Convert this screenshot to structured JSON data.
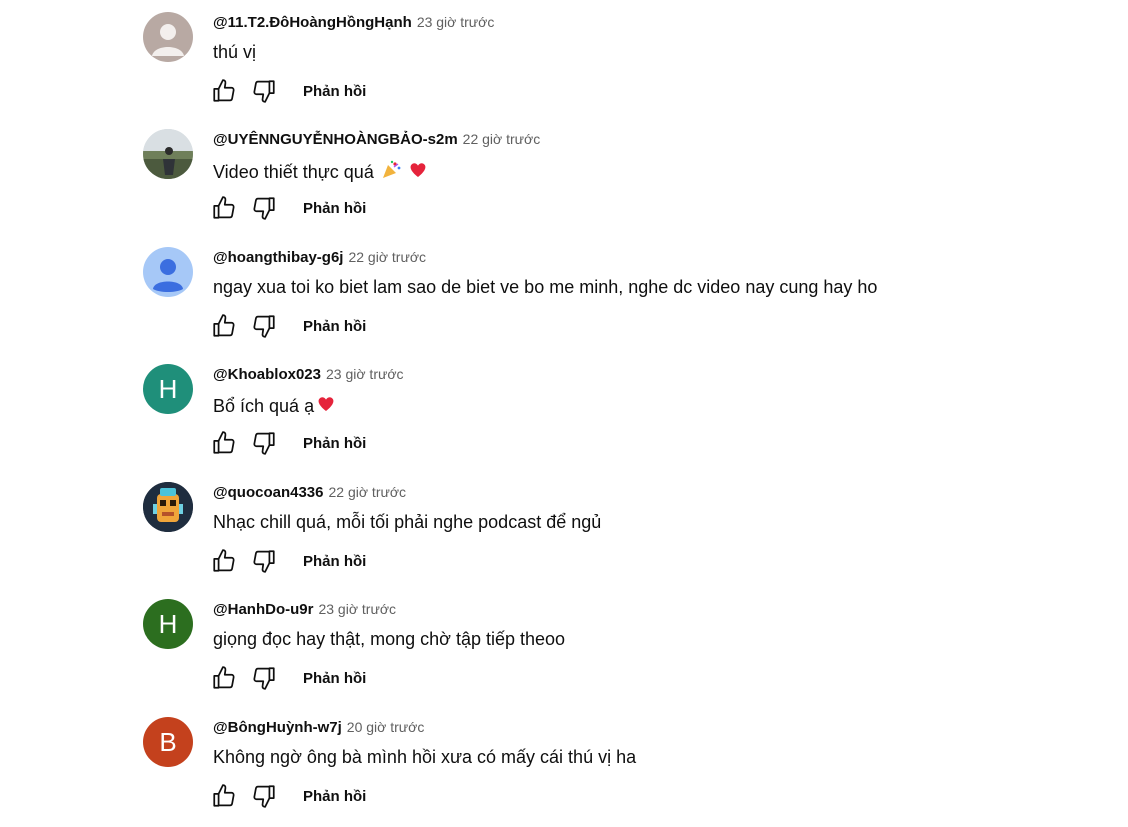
{
  "colors": {
    "text": "#0f0f0f",
    "meta": "#606060",
    "avatar_green": "#1f8f7a",
    "avatar_darkgreen": "#2c6e1f",
    "avatar_orange": "#c4411d",
    "avatar_gray": "#b8a9a3",
    "avatar_blue": "#a6c8f7",
    "heart": "#e5233b"
  },
  "reply_label": "Phản hồi",
  "comments": [
    {
      "author": "@11.T2.ĐôHoàngHồngHạnh",
      "time": "23 giờ trước",
      "text": "thú vị",
      "avatar": {
        "type": "default-person-icon",
        "bg": "#b8a9a3"
      }
    },
    {
      "author": "@UYÊNNGUYỄNHOÀNGBẢO-s2m",
      "time": "22 giờ trước",
      "text": "Video thiết thực quá",
      "emojis": [
        "party-popper-icon",
        "heart-icon"
      ],
      "avatar": {
        "type": "photo"
      }
    },
    {
      "author": "@hoangthibay-g6j",
      "time": "22 giờ trước",
      "text": "ngay xua toi ko biet lam sao de biet ve bo me minh, nghe dc video nay cung hay ho",
      "avatar": {
        "type": "default-person-icon",
        "bg": "#a6c8f7"
      }
    },
    {
      "author": "@Khoablox023",
      "time": "23 giờ trước",
      "text": "Bổ ích quá ạ",
      "emojis": [
        "heart-icon"
      ],
      "avatar": {
        "type": "letter",
        "letter": "H",
        "bg": "#1f8f7a"
      }
    },
    {
      "author": "@quocoan4336",
      "time": "22 giờ trước",
      "text": "Nhạc chill quá, mỗi tối phải nghe podcast để ngủ",
      "avatar": {
        "type": "game-character"
      }
    },
    {
      "author": "@HanhDo-u9r",
      "time": "23 giờ trước",
      "text": "giọng đọc hay thật, mong chờ tập tiếp theoo",
      "avatar": {
        "type": "letter",
        "letter": "H",
        "bg": "#2c6e1f"
      }
    },
    {
      "author": "@BôngHuỳnh-w7j",
      "time": "20 giờ trước",
      "text": "Không ngờ ông bà mình hồi xưa có mấy cái thú vị ha",
      "avatar": {
        "type": "letter",
        "letter": "B",
        "bg": "#c4411d"
      }
    }
  ]
}
